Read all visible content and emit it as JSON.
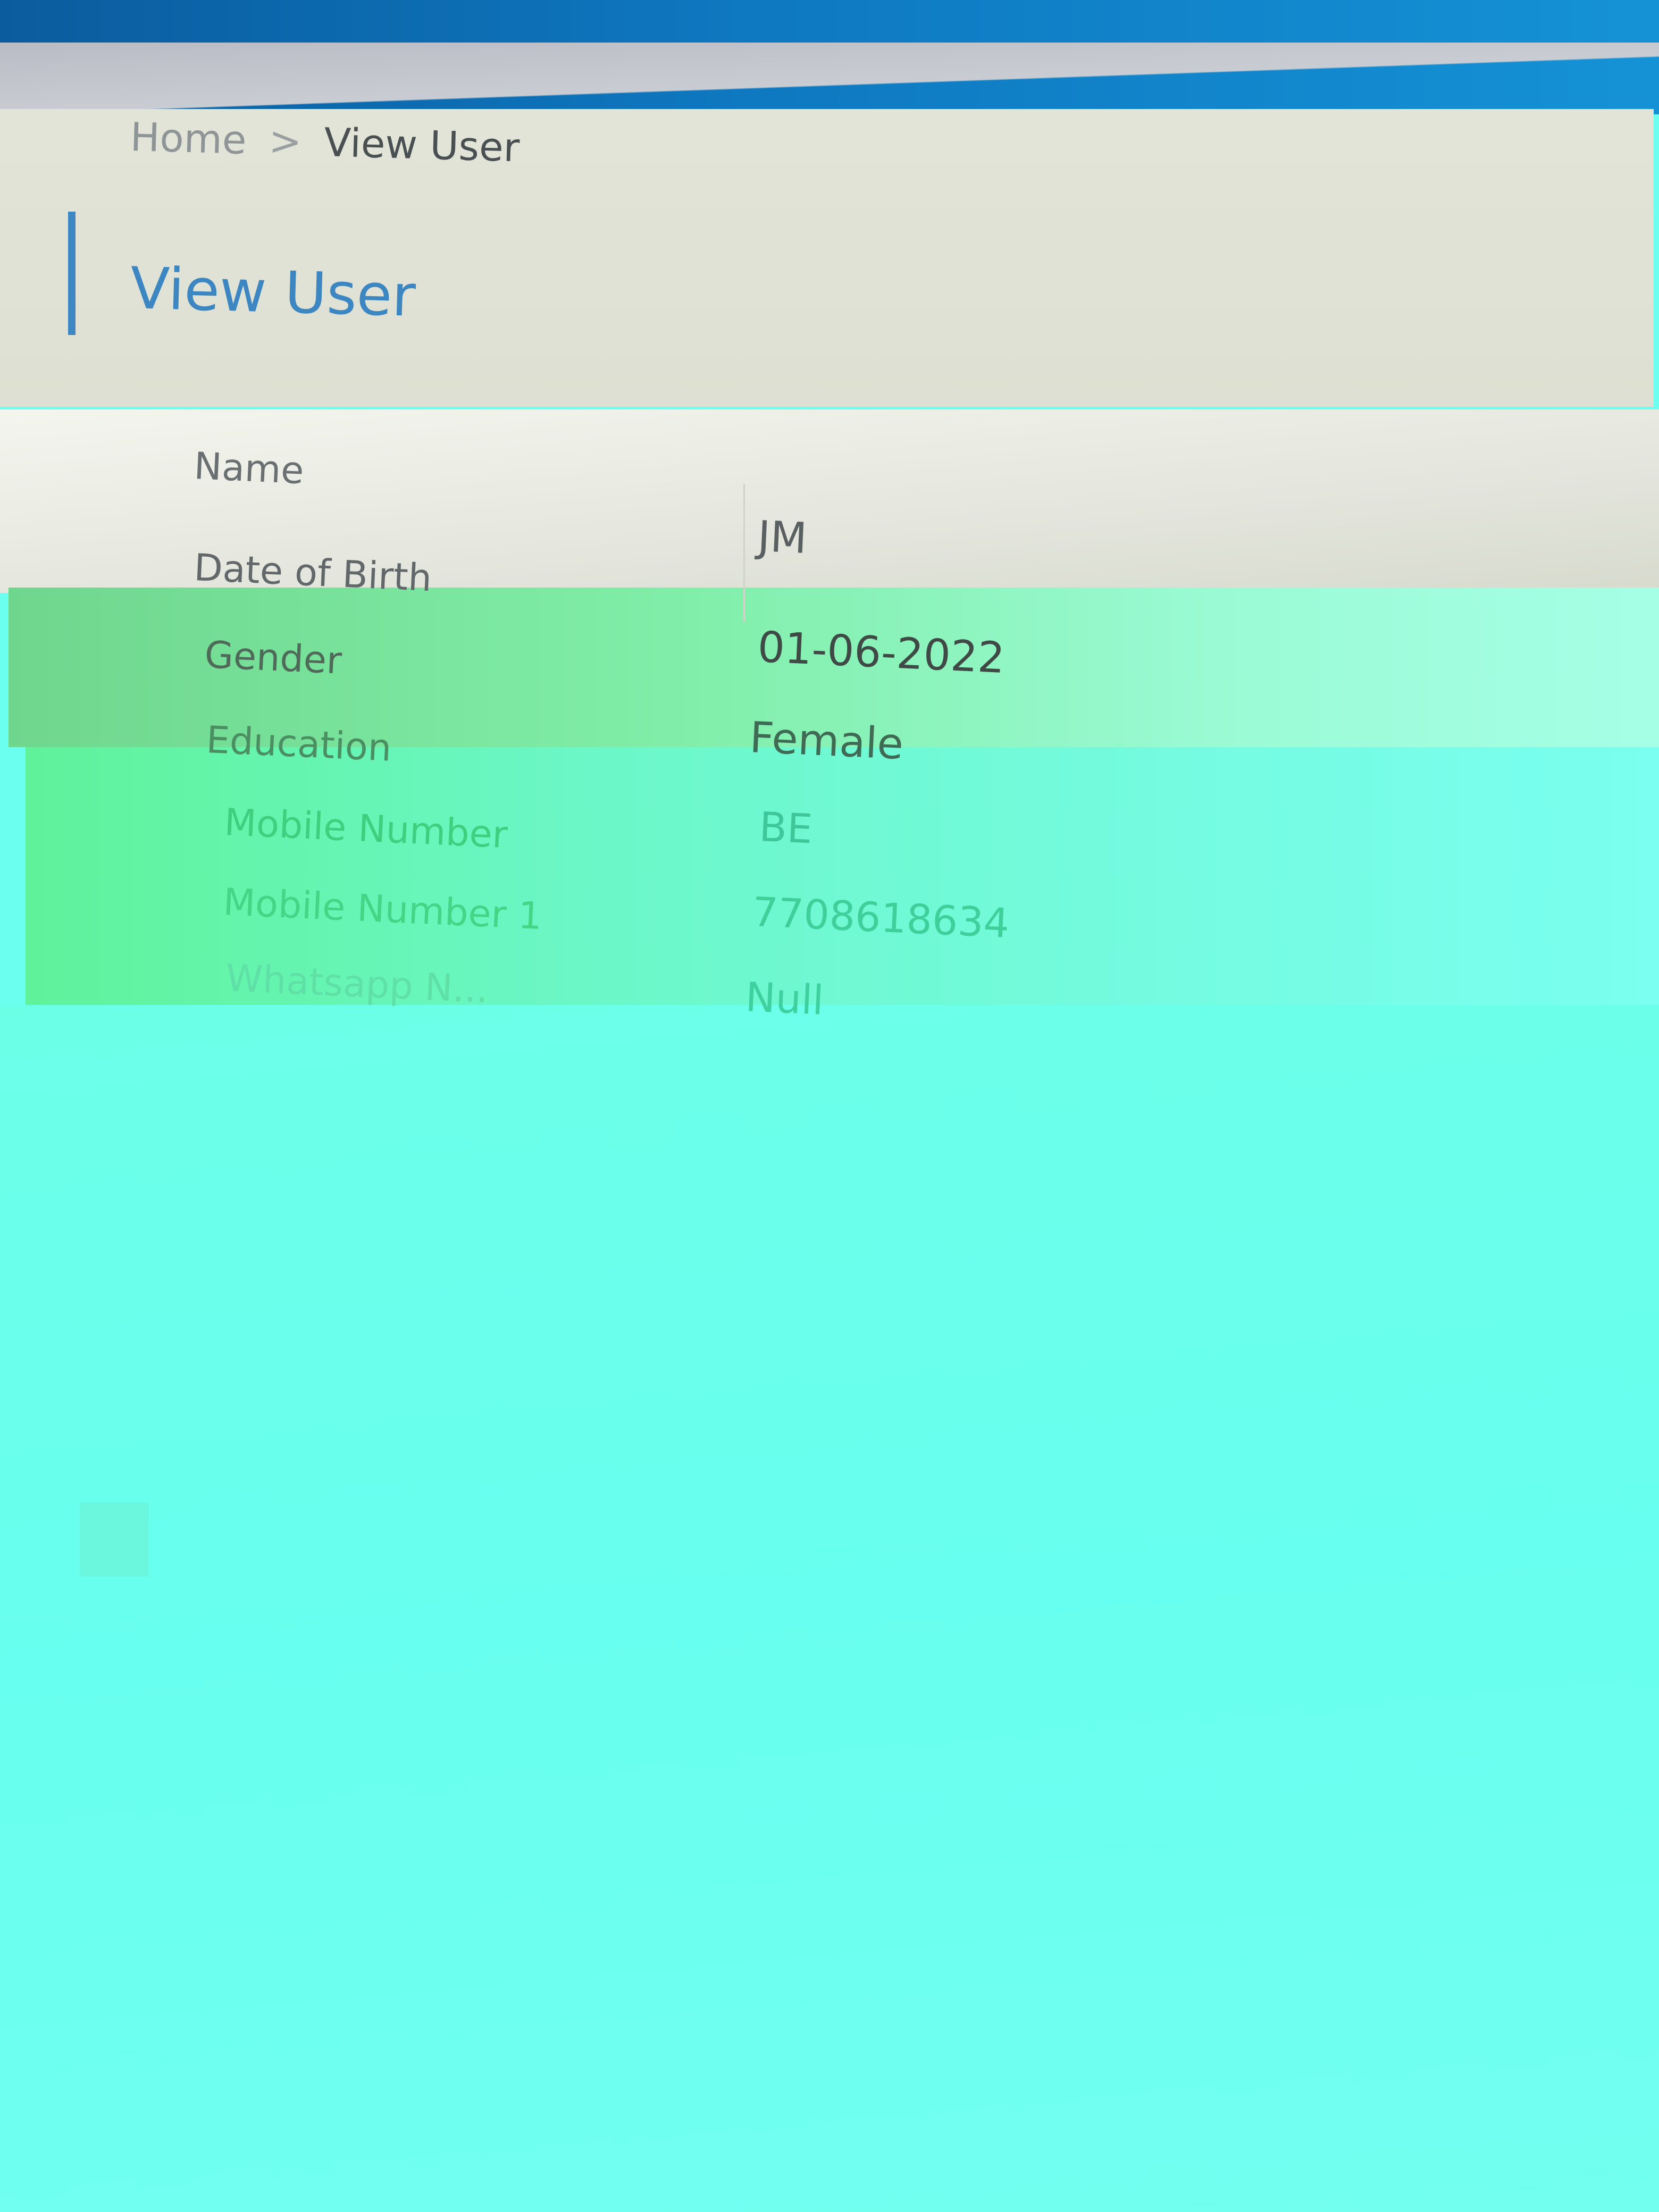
{
  "breadcrumb": {
    "home": "Home",
    "separator": ">",
    "current": "View User"
  },
  "page": {
    "title": "View User"
  },
  "user_details": [
    {
      "label": "Name",
      "value": "JM"
    },
    {
      "label": "Date of Birth",
      "value": "01-06-2022"
    },
    {
      "label": "Gender",
      "value": "Female"
    },
    {
      "label": "Education",
      "value": "BE"
    },
    {
      "label": "Mobile Number",
      "value": "7708618634"
    },
    {
      "label": "Mobile Number 1",
      "value": "Null"
    },
    {
      "label": "Whatsapp N...",
      "value": ""
    }
  ],
  "colors": {
    "accent": "#3d87c4",
    "topbar": "#0e78c0",
    "label_text": "#5d6466",
    "value_text": "#3f4546"
  }
}
